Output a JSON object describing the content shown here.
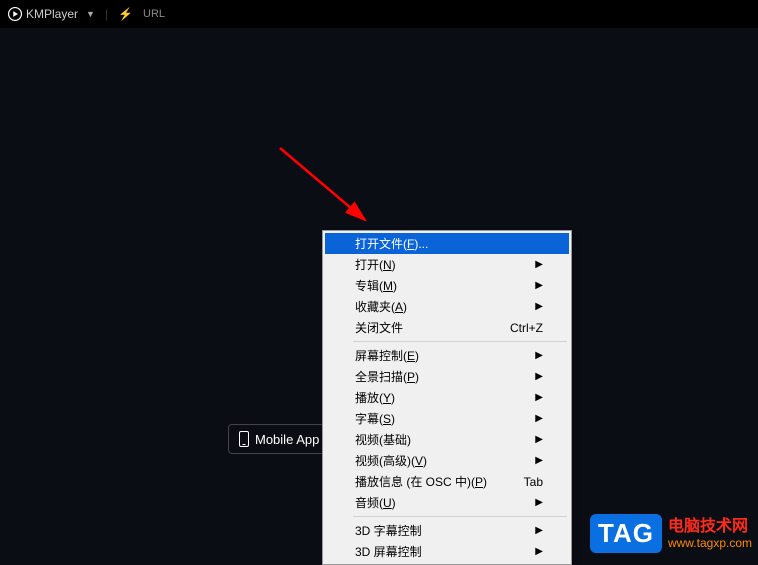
{
  "titlebar": {
    "app_name": "KMPlayer",
    "url_label": "URL"
  },
  "mobile_button": {
    "label": "Mobile App"
  },
  "context_menu": {
    "items": [
      {
        "label": "打开文件(F)...",
        "highlighted": true
      },
      {
        "label": "打开(N)",
        "submenu": true
      },
      {
        "label": "专辑(M)",
        "submenu": true
      },
      {
        "label": "收藏夹(A)",
        "submenu": true
      },
      {
        "label": "关闭文件",
        "shortcut": "Ctrl+Z"
      },
      {
        "separator": true
      },
      {
        "label": "屏幕控制(E)",
        "submenu": true
      },
      {
        "label": "全景扫描(P)",
        "submenu": true
      },
      {
        "label": "播放(Y)",
        "submenu": true
      },
      {
        "label": "字幕(S)",
        "submenu": true
      },
      {
        "label": "视频(基础)",
        "submenu": true
      },
      {
        "label": "视频(高级)(V)",
        "submenu": true
      },
      {
        "label": "播放信息 (在 OSC 中)(P)",
        "shortcut": "Tab"
      },
      {
        "label": "音频(U)",
        "submenu": true
      },
      {
        "separator": true
      },
      {
        "label": "3D 字幕控制",
        "submenu": true
      },
      {
        "label": "3D 屏幕控制",
        "submenu": true
      }
    ]
  },
  "watermark": {
    "badge": "TAG",
    "line1": "电脑技术网",
    "line2": "www.tagxp.com"
  }
}
